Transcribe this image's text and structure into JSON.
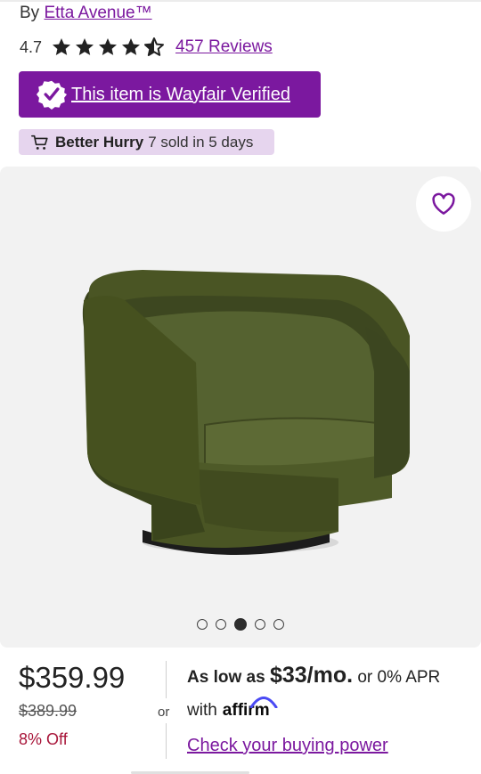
{
  "brand": {
    "prefix": "By",
    "name": "Etta Avenue™"
  },
  "rating": {
    "value": "4.7",
    "stars": 4.7,
    "reviews_label": "457 Reviews"
  },
  "verified_badge": {
    "label": "This item is Wayfair Verified"
  },
  "urgency": {
    "bold": "Better Hurry",
    "text": "7 sold in 5 days"
  },
  "gallery": {
    "image_count": 5,
    "active_index": 2,
    "image_subject": "olive green velvet swivel barrel chair"
  },
  "pricing": {
    "price": "$359.99",
    "was_price": "$389.99",
    "discount": "8% Off"
  },
  "financing": {
    "or_label": "or",
    "as_low_as": "As low as",
    "monthly": "$33/mo.",
    "apr_text": "or 0% APR",
    "with_label": "with",
    "affirm_logo_text": "affirm",
    "cta": "Check your buying power"
  },
  "colors": {
    "accent": "#7b189f",
    "urgency_bg": "#e6d5ee",
    "discount": "#a8163a",
    "chair": "#4a5524"
  }
}
